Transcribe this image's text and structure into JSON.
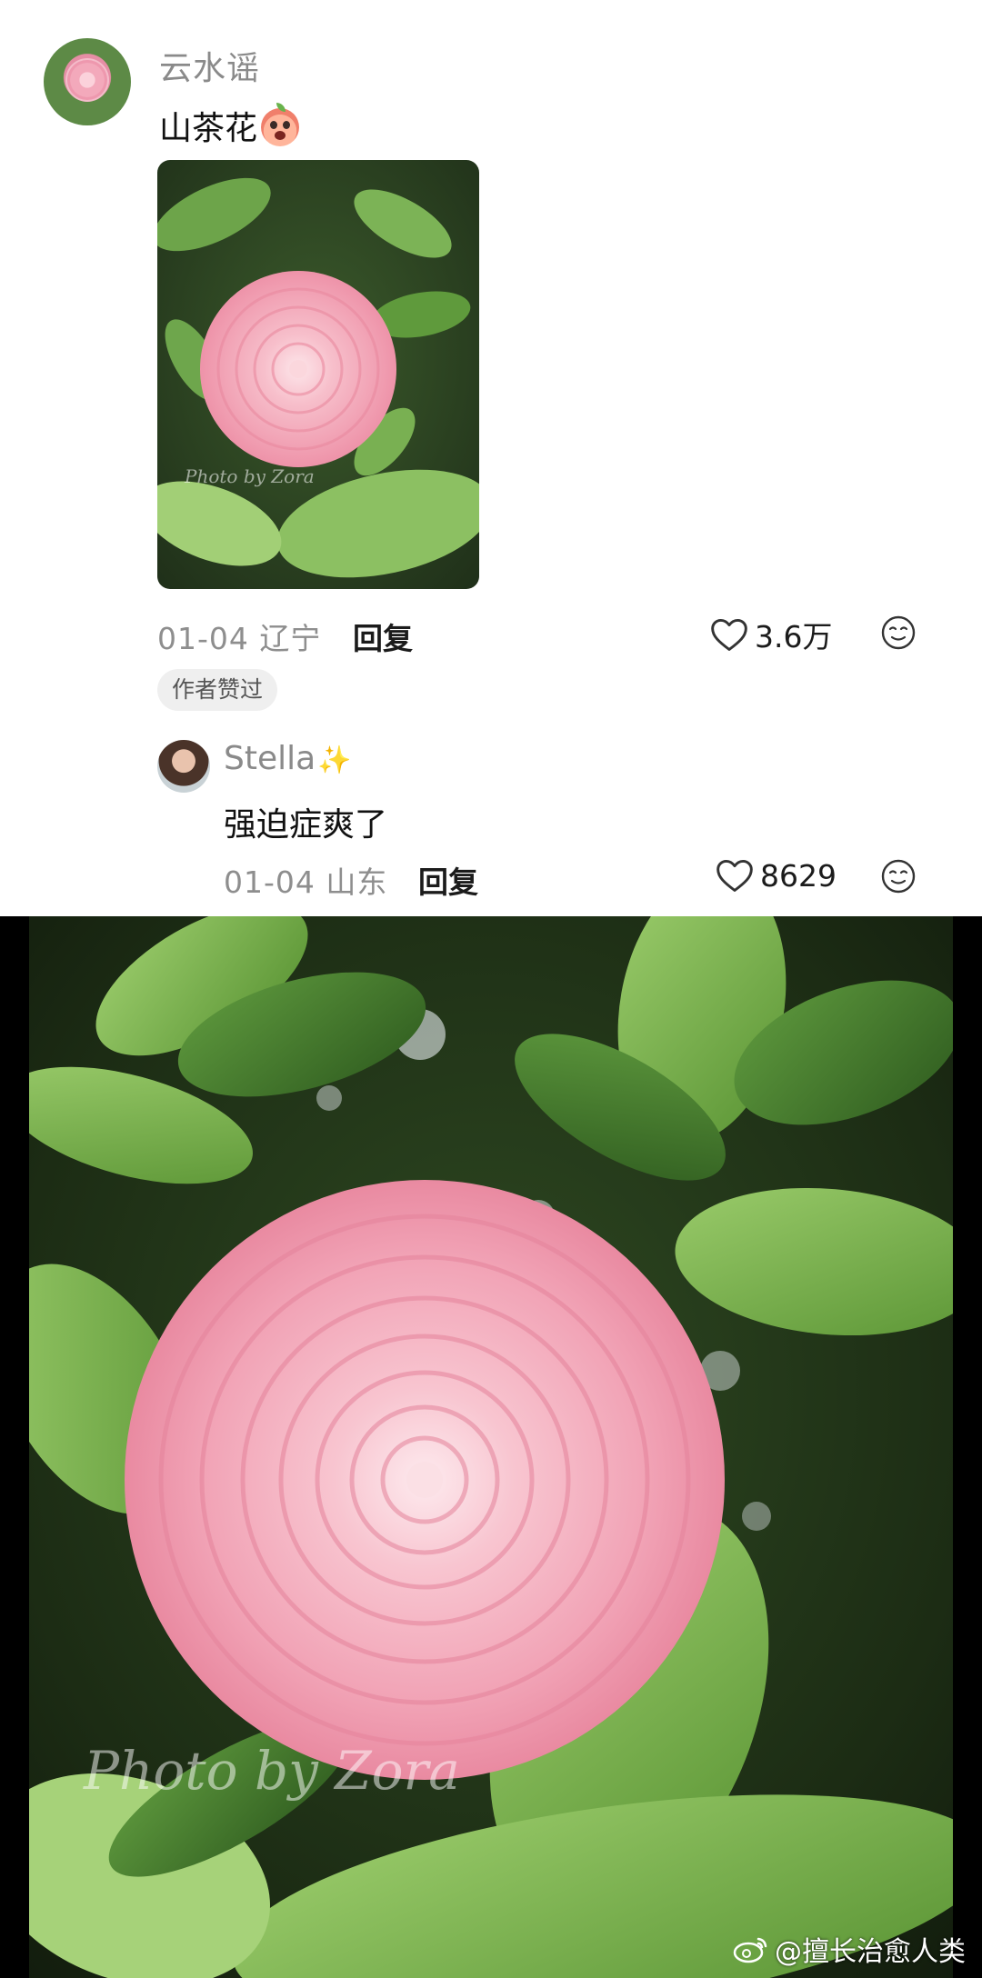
{
  "comment": {
    "username": "云水谣",
    "text": "山茶花",
    "emoji": "surprised-peach-emoji",
    "date_location": "01-04 辽宁",
    "reply_label": "回复",
    "likes": "3.6万",
    "badge": "作者赞过"
  },
  "reply": {
    "username": "Stella",
    "name_emoji": "✨",
    "text": "强迫症爽了",
    "date_location": "01-04 山东",
    "reply_label": "回复",
    "likes": "8629"
  },
  "photo": {
    "watermark": "Photo by Zora"
  },
  "footer": {
    "weibo_watermark": "@擅长治愈人类"
  },
  "colors": {
    "petal_pink": "#f4a7b6",
    "leaf_green": "#5f9a3c",
    "meta_gray": "#8e8e8e"
  },
  "icons": {
    "like": "heart-outline-icon",
    "emoji_react": "emoji-face-icon",
    "weibo": "weibo-logo-icon"
  }
}
